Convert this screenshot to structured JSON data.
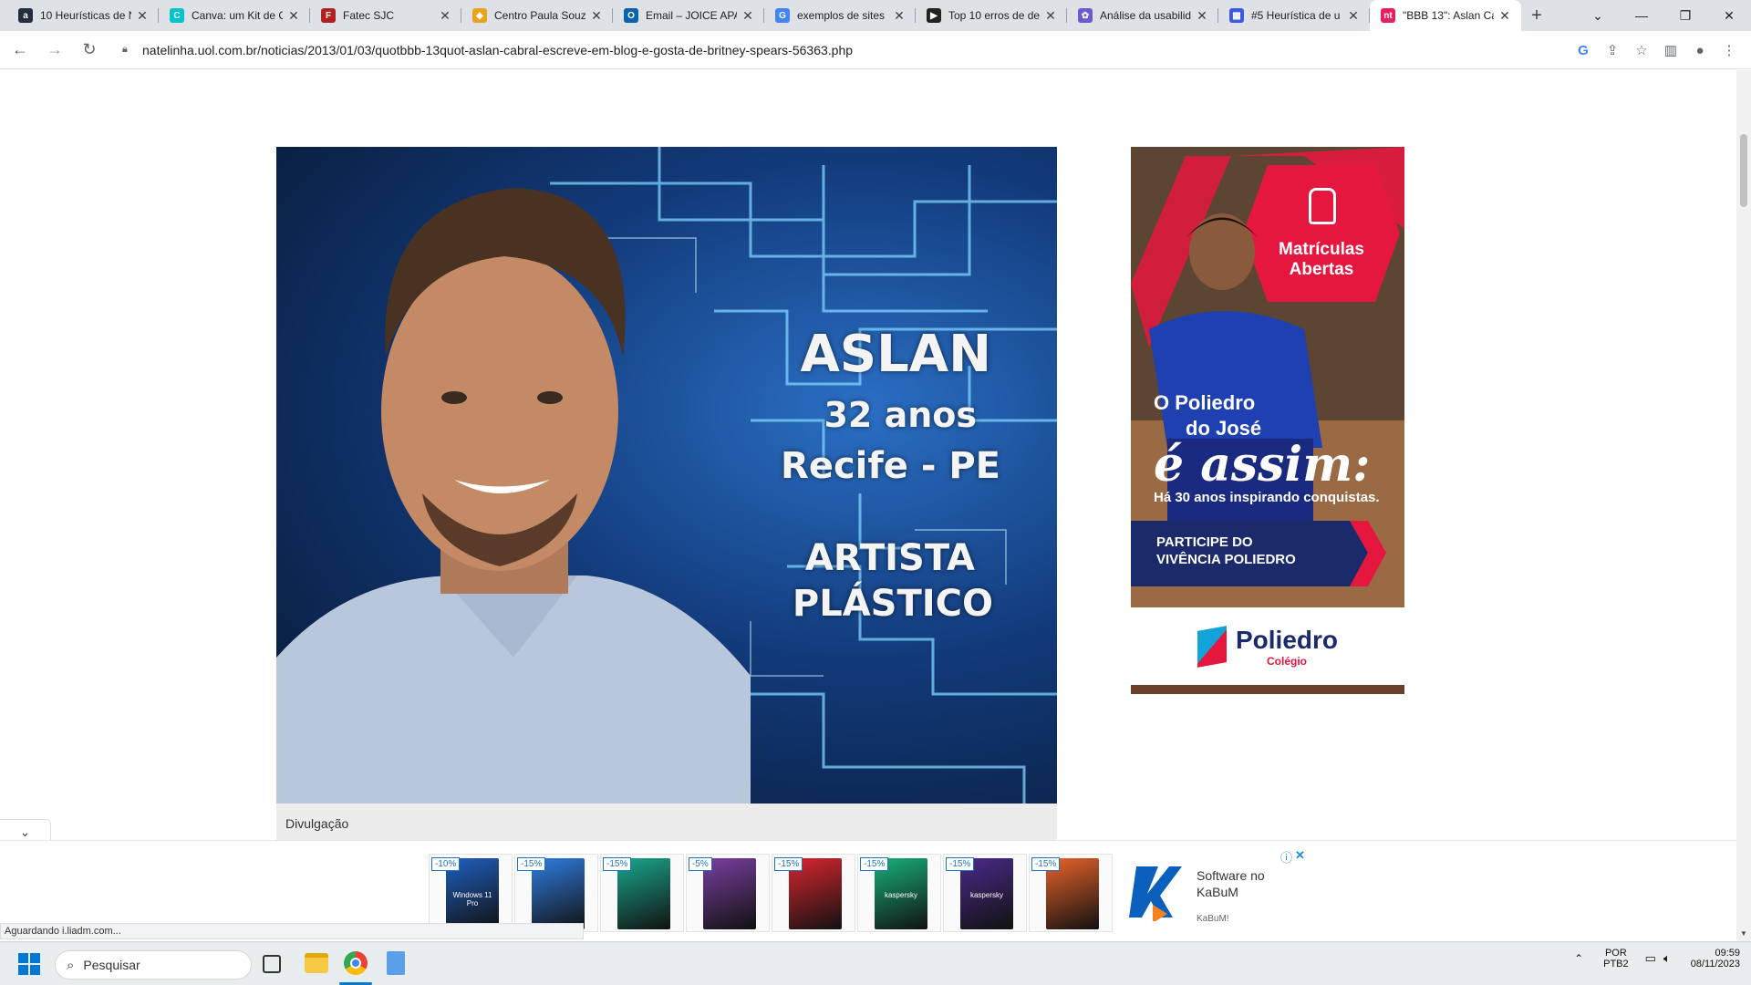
{
  "browser": {
    "tabs": [
      {
        "title": "10 Heurísticas de N",
        "favicon_text": "a",
        "favicon_color": "#232f3e"
      },
      {
        "title": "Canva: um Kit de C",
        "favicon_text": "C",
        "favicon_color": "#00c4cc"
      },
      {
        "title": "Fatec SJC",
        "favicon_text": "F",
        "favicon_color": "#b22222"
      },
      {
        "title": "Centro Paula Souza",
        "favicon_text": "◆",
        "favicon_color": "#e8a317"
      },
      {
        "title": "Email – JOICE APAR",
        "favicon_text": "O",
        "favicon_color": "#0a64ad"
      },
      {
        "title": "exemplos de sites",
        "favicon_text": "G",
        "favicon_color": "#4285f4"
      },
      {
        "title": "Top 10 erros de de",
        "favicon_text": "▶",
        "favicon_color": "#222222"
      },
      {
        "title": "Análise da usabilid",
        "favicon_text": "✿",
        "favicon_color": "#6a5acd"
      },
      {
        "title": "#5 Heurística de u",
        "favicon_text": "▦",
        "favicon_color": "#3b5bdb"
      },
      {
        "title": "\"BBB 13\": Aslan Ca",
        "favicon_text": "nt",
        "favicon_color": "#e91e63",
        "active": true
      }
    ],
    "new_tab": "+",
    "url": "natelinha.uol.com.br/noticias/2013/01/03/quotbbb-13quot-aslan-cabral-escreve-em-blog-e-gosta-de-britney-spears-56363.php",
    "status_text": "Aguardando i.liadm.com..."
  },
  "article": {
    "hero": {
      "name": "ASLAN",
      "age": "32 anos",
      "city": "Recife - PE",
      "job_line1": "ARTISTA",
      "job_line2": "PLÁSTICO"
    },
    "caption": "Divulgação"
  },
  "side_ad": {
    "badge_line1": "Matrículas",
    "badge_line2": "Abertas",
    "headline1": "O Poliedro",
    "headline2": "do José",
    "headline3": "é assim:",
    "tagline": "Há 30 anos inspirando conquistas.",
    "cta_line1": "PARTICIPE DO",
    "cta_line2": "VIVÊNCIA POLIEDRO",
    "brand": "Poliedro",
    "brand_sub": "Colégio",
    "accent": "#e5173f",
    "navy": "#1b2a6b"
  },
  "bottom_ad": {
    "products": [
      {
        "discount": "-10%",
        "color": "#1f5fbf",
        "label": "Windows 11 Pro"
      },
      {
        "discount": "-15%",
        "color": "#2f7de1",
        "label": ""
      },
      {
        "discount": "-15%",
        "color": "#1aa78c",
        "label": ""
      },
      {
        "discount": "-5%",
        "color": "#7a3fa0",
        "label": ""
      },
      {
        "discount": "-15%",
        "color": "#d8262f",
        "label": ""
      },
      {
        "discount": "-15%",
        "color": "#18b07a",
        "label": "kaspersky"
      },
      {
        "discount": "-15%",
        "color": "#4b2a8a",
        "label": "kaspersky"
      },
      {
        "discount": "-15%",
        "color": "#e8632a",
        "label": ""
      }
    ],
    "advertiser_line1": "Software no",
    "advertiser_line2": "KaBuM",
    "advertiser_small": "KaBuM!",
    "info_icon": "ⓘ",
    "close_icon": "✕"
  },
  "taskbar": {
    "search_placeholder": "Pesquisar",
    "lang1": "POR",
    "lang2": "PTB2",
    "time": "09:59",
    "date": "08/11/2023"
  }
}
